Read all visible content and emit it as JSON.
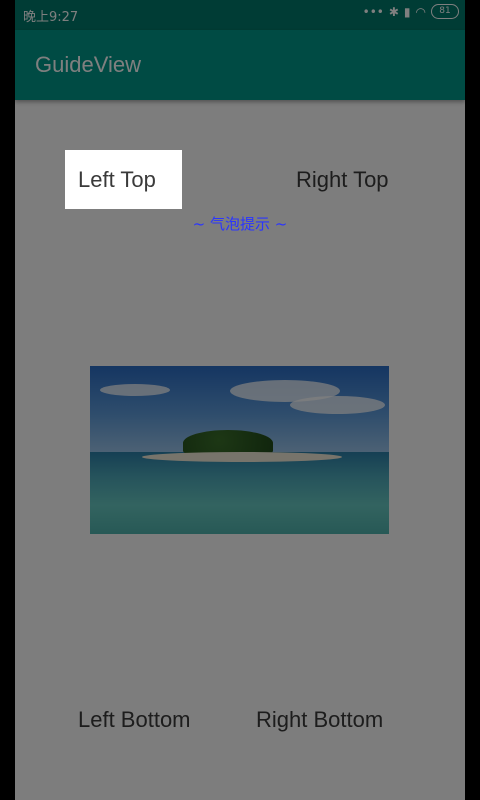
{
  "status_bar": {
    "time": "晚上9:27",
    "icons": [
      "more-dots-icon",
      "bluetooth-icon",
      "signal-hd-icon",
      "wifi-icon",
      "battery-icon"
    ],
    "battery": "81"
  },
  "app_bar": {
    "title": "GuideView"
  },
  "buttons": {
    "left_top": "Left Top",
    "right_top": "Right Top",
    "left_bottom": "Left Bottom",
    "right_bottom": "Right Bottom"
  },
  "guide": {
    "tip": "~ 气泡提示 ~"
  },
  "colors": {
    "primary": "#009688",
    "primary_dark": "#00796b",
    "tip": "#2a35ff"
  }
}
